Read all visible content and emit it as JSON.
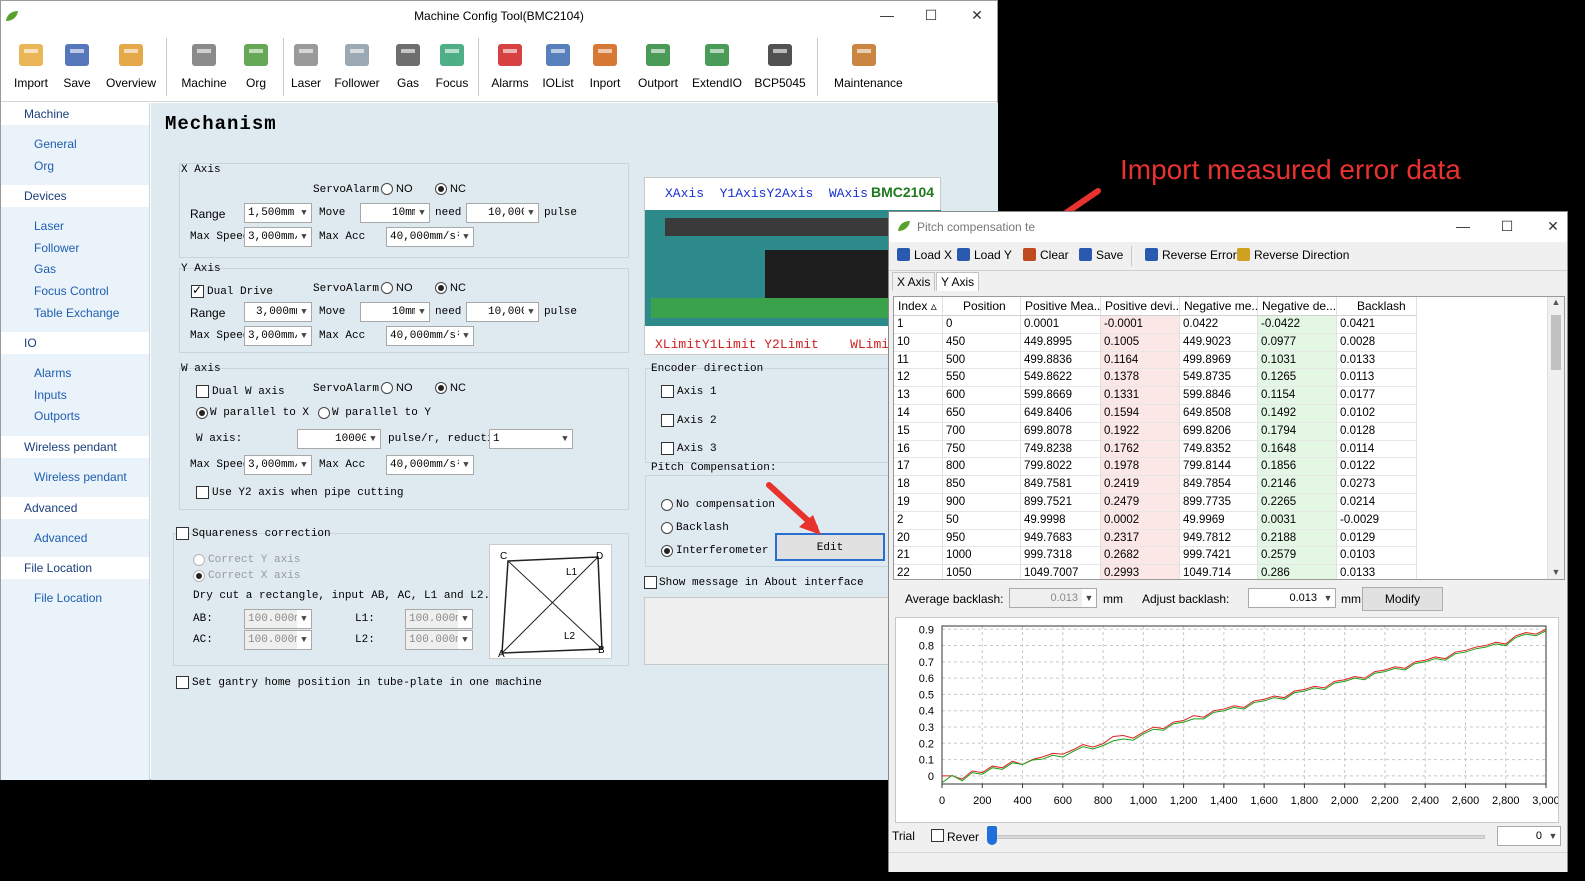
{
  "main_window": {
    "title": "Machine Config Tool(BMC2104)",
    "toolbar": [
      {
        "label": "Import",
        "icon": "folder-open-icon"
      },
      {
        "label": "Save",
        "icon": "floppy-disk-icon"
      },
      {
        "label": "Overview",
        "icon": "overview-icon"
      },
      {
        "label": "Machine",
        "icon": "machine-icon"
      },
      {
        "label": "Org",
        "icon": "origin-arrow-icon"
      },
      {
        "label": "Laser",
        "icon": "laser-icon"
      },
      {
        "label": "Follower",
        "icon": "follower-icon"
      },
      {
        "label": "Gas",
        "icon": "gauge-icon"
      },
      {
        "label": "Focus",
        "icon": "focus-icon"
      },
      {
        "label": "Alarms",
        "icon": "alarm-light-icon"
      },
      {
        "label": "IOList",
        "icon": "table-icon"
      },
      {
        "label": "Inport",
        "icon": "inport-icon"
      },
      {
        "label": "Outport",
        "icon": "outport-icon"
      },
      {
        "label": "ExtendIO",
        "icon": "circuit-board-icon"
      },
      {
        "label": "BCP5045",
        "icon": "device-icon"
      },
      {
        "label": "Maintenance",
        "icon": "tools-icon"
      }
    ],
    "sidebar": [
      {
        "header": "Machine",
        "items": [
          "General",
          "Org"
        ]
      },
      {
        "header": "Devices",
        "items": [
          "Laser",
          "Follower",
          "Gas",
          "Focus Control",
          "Table Exchange"
        ]
      },
      {
        "header": "IO",
        "items": [
          "Alarms",
          "Inputs",
          "Outports"
        ]
      },
      {
        "header": "Wireless pendant",
        "items": [
          "Wireless pendant"
        ]
      },
      {
        "header": "Advanced",
        "items": [
          "Advanced"
        ]
      },
      {
        "header": "File Location",
        "items": [
          "File Location"
        ]
      }
    ],
    "page_title": "Mechanism",
    "x_axis": {
      "title": "X Axis",
      "servo_alarm": "ServoAlarm",
      "no": "NO",
      "nc": "NC",
      "range_label": "Range",
      "range": "1,500mm",
      "move_label": "Move",
      "move": "10mm",
      "need_label": "need",
      "need": "10,000",
      "pulse": "pulse",
      "max_speed_label": "Max Speed",
      "max_speed": "3,000mm/",
      "max_acc_label": "Max Acc",
      "max_acc": "40,000mm/s²"
    },
    "y_axis": {
      "title": "Y Axis",
      "dual_drive": "Dual Drive",
      "servo_alarm": "ServoAlarm",
      "no": "NO",
      "nc": "NC",
      "range_label": "Range",
      "range": "3,000mm",
      "move_label": "Move",
      "move": "10mm",
      "need_label": "need",
      "need": "10,000",
      "pulse": "pulse",
      "max_speed_label": "Max Speed",
      "max_speed": "3,000mm/",
      "max_acc_label": "Max Acc",
      "max_acc": "40,000mm/s²"
    },
    "w_axis": {
      "title": "W axis",
      "dual_w": "Dual W axis",
      "servo_alarm": "ServoAlarm",
      "no": "NO",
      "nc": "NC",
      "parallel_x": "W parallel to X",
      "parallel_y": "W parallel to Y",
      "w_axis_label": "W axis:",
      "w_axis_value": "10000",
      "pulse_r": "pulse/r, reductio",
      "reduction": "1",
      "max_speed_label": "Max Speed",
      "max_speed": "3,000mm/",
      "max_acc_label": "Max Acc",
      "max_acc": "40,000mm/s²",
      "use_y2": "Use Y2 axis when pipe cutting"
    },
    "squareness": {
      "title": "Squareness correction",
      "correct_y": "Correct Y axis",
      "correct_x": "Correct X axis",
      "instruction": "Dry cut a rectangle, input AB, AC, L1 and L2.",
      "ab_label": "AB:",
      "ab": "100.000m",
      "ac_label": "AC:",
      "ac": "100.000m",
      "l1_label": "L1:",
      "l1": "100.000m",
      "l2_label": "L2:",
      "l2": "100.000m",
      "diagram": {
        "c": "C",
        "d": "D",
        "a": "A",
        "b": "B",
        "l1": "L1",
        "l2": "L2"
      }
    },
    "gantry": "Set gantry home position in tube-plate in one machine",
    "board": {
      "name": "BMC2104",
      "top_labels": [
        "XAxis",
        "Y1Axis",
        "Y2Axis",
        "WAxis"
      ],
      "bottom_labels": [
        "XLimit",
        "Y1Limit",
        "Y2Limit",
        "WLimit"
      ]
    },
    "encoder": {
      "title": "Encoder direction",
      "axes": [
        "Axis 1",
        "Axis 2",
        "Axis 3"
      ]
    },
    "pitch_comp": {
      "title": "Pitch Compensation:",
      "options": [
        "No compensation",
        "Backlash",
        "Interferometer"
      ],
      "selected": "Interferometer",
      "edit_button": "Edit"
    },
    "show_message": "Show message in About interface"
  },
  "annotation": "Import measured error data",
  "pitch_window": {
    "title": "Pitch compensation te",
    "toolbar": [
      "Load X",
      "Load Y",
      "Clear",
      "Save",
      "Reverse Error",
      "Reverse Direction"
    ],
    "tabs": [
      "X Axis",
      "Y Axis"
    ],
    "active_tab": "Y Axis",
    "columns": [
      "Index",
      "Position",
      "Positive Mea...",
      "Positive devi...",
      "Negative me...",
      "Negative de...",
      "Backlash"
    ],
    "rows": [
      [
        "1",
        "0",
        "0.0001",
        "-0.0001",
        "0.0422",
        "-0.0422",
        "0.0421"
      ],
      [
        "10",
        "450",
        "449.8995",
        "0.1005",
        "449.9023",
        "0.0977",
        "0.0028"
      ],
      [
        "11",
        "500",
        "499.8836",
        "0.1164",
        "499.8969",
        "0.1031",
        "0.0133"
      ],
      [
        "12",
        "550",
        "549.8622",
        "0.1378",
        "549.8735",
        "0.1265",
        "0.0113"
      ],
      [
        "13",
        "600",
        "599.8669",
        "0.1331",
        "599.8846",
        "0.1154",
        "0.0177"
      ],
      [
        "14",
        "650",
        "649.8406",
        "0.1594",
        "649.8508",
        "0.1492",
        "0.0102"
      ],
      [
        "15",
        "700",
        "699.8078",
        "0.1922",
        "699.8206",
        "0.1794",
        "0.0128"
      ],
      [
        "16",
        "750",
        "749.8238",
        "0.1762",
        "749.8352",
        "0.1648",
        "0.0114"
      ],
      [
        "17",
        "800",
        "799.8022",
        "0.1978",
        "799.8144",
        "0.1856",
        "0.0122"
      ],
      [
        "18",
        "850",
        "849.7581",
        "0.2419",
        "849.7854",
        "0.2146",
        "0.0273"
      ],
      [
        "19",
        "900",
        "899.7521",
        "0.2479",
        "899.7735",
        "0.2265",
        "0.0214"
      ],
      [
        "2",
        "50",
        "49.9998",
        "0.0002",
        "49.9969",
        "0.0031",
        "-0.0029"
      ],
      [
        "20",
        "950",
        "949.7683",
        "0.2317",
        "949.7812",
        "0.2188",
        "0.0129"
      ],
      [
        "21",
        "1000",
        "999.7318",
        "0.2682",
        "999.7421",
        "0.2579",
        "0.0103"
      ],
      [
        "22",
        "1050",
        "1049.7007",
        "0.2993",
        "1049.714",
        "0.286",
        "0.0133"
      ]
    ],
    "avg_backlash_label": "Average backlash:",
    "avg_backlash": "0.013",
    "unit": "mm",
    "adjust_backlash_label": "Adjust backlash:",
    "adjust_backlash": "0.013",
    "modify": "Modify",
    "trial": "Trial",
    "rever": "Rever",
    "trial_value": "0",
    "slider_position": 0
  },
  "chart_data": {
    "type": "line",
    "x_ticks": [
      "0",
      "200",
      "400",
      "600",
      "800",
      "1,000",
      "1,200",
      "1,400",
      "1,600",
      "1,800",
      "2,000",
      "2,200",
      "2,400",
      "2,600",
      "2,800",
      "3,000"
    ],
    "y_ticks": [
      "0",
      "0.1",
      "0.2",
      "0.3",
      "0.4",
      "0.5",
      "0.6",
      "0.7",
      "0.8",
      "0.9"
    ],
    "xlim": [
      0,
      3000
    ],
    "ylim": [
      -0.05,
      0.92
    ],
    "grid": true,
    "series": [
      {
        "color": "#e02020",
        "x": [
          0,
          50,
          100,
          150,
          200,
          250,
          300,
          350,
          400,
          450,
          500,
          550,
          600,
          650,
          700,
          750,
          800,
          850,
          900,
          950,
          1000,
          1050,
          1100,
          1150,
          1200,
          1250,
          1300,
          1350,
          1400,
          1450,
          1500,
          1550,
          1600,
          1650,
          1700,
          1750,
          1800,
          1850,
          1900,
          1950,
          2000,
          2050,
          2100,
          2150,
          2200,
          2250,
          2300,
          2350,
          2400,
          2450,
          2500,
          2550,
          2600,
          2650,
          2700,
          2750,
          2800,
          2850,
          2900,
          2950,
          3000
        ],
        "y": [
          -0.0001,
          0.0002,
          -0.02,
          0.03,
          0.02,
          0.06,
          0.05,
          0.09,
          0.07,
          0.1005,
          0.1164,
          0.1378,
          0.1331,
          0.1594,
          0.1922,
          0.1762,
          0.1978,
          0.2419,
          0.2479,
          0.2317,
          0.2682,
          0.2993,
          0.29,
          0.33,
          0.34,
          0.37,
          0.36,
          0.4,
          0.41,
          0.43,
          0.42,
          0.46,
          0.47,
          0.49,
          0.48,
          0.52,
          0.53,
          0.55,
          0.54,
          0.58,
          0.59,
          0.61,
          0.6,
          0.64,
          0.65,
          0.67,
          0.66,
          0.7,
          0.71,
          0.73,
          0.72,
          0.76,
          0.77,
          0.79,
          0.8,
          0.82,
          0.81,
          0.86,
          0.88,
          0.87,
          0.9
        ]
      },
      {
        "color": "#1aa01a",
        "x": [
          0,
          50,
          100,
          150,
          200,
          250,
          300,
          350,
          400,
          450,
          500,
          550,
          600,
          650,
          700,
          750,
          800,
          850,
          900,
          950,
          1000,
          1050,
          1100,
          1150,
          1200,
          1250,
          1300,
          1350,
          1400,
          1450,
          1500,
          1550,
          1600,
          1650,
          1700,
          1750,
          1800,
          1850,
          1900,
          1950,
          2000,
          2050,
          2100,
          2150,
          2200,
          2250,
          2300,
          2350,
          2400,
          2450,
          2500,
          2550,
          2600,
          2650,
          2700,
          2750,
          2800,
          2850,
          2900,
          2950,
          3000
        ],
        "y": [
          -0.0422,
          0.0031,
          -0.03,
          0.02,
          0.01,
          0.05,
          0.04,
          0.08,
          0.07,
          0.0977,
          0.1031,
          0.1265,
          0.1154,
          0.1492,
          0.1794,
          0.1648,
          0.1856,
          0.2146,
          0.2265,
          0.2188,
          0.2579,
          0.286,
          0.28,
          0.32,
          0.33,
          0.35,
          0.35,
          0.39,
          0.4,
          0.42,
          0.41,
          0.45,
          0.46,
          0.48,
          0.47,
          0.51,
          0.52,
          0.54,
          0.53,
          0.57,
          0.58,
          0.6,
          0.59,
          0.63,
          0.64,
          0.66,
          0.65,
          0.69,
          0.7,
          0.72,
          0.71,
          0.75,
          0.76,
          0.78,
          0.79,
          0.81,
          0.8,
          0.85,
          0.87,
          0.86,
          0.89
        ]
      }
    ]
  }
}
